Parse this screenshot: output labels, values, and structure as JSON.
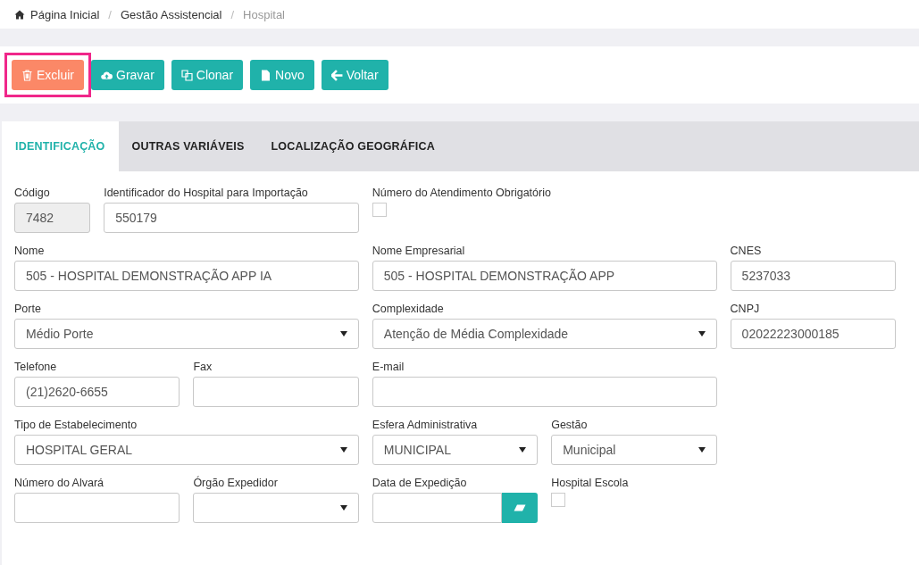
{
  "breadcrumb": [
    {
      "label": "Página Inicial",
      "current": false
    },
    {
      "label": "Gestão Assistencial",
      "current": false
    },
    {
      "label": "Hospital",
      "current": true
    }
  ],
  "breadcrumb_separator": "/",
  "toolbar": [
    {
      "label": "Excluir",
      "kind": "danger",
      "highlighted": true
    },
    {
      "label": "Gravar",
      "kind": "primary",
      "highlighted": false
    },
    {
      "label": "Clonar",
      "kind": "primary",
      "highlighted": false
    },
    {
      "label": "Novo",
      "kind": "primary",
      "highlighted": false
    },
    {
      "label": "Voltar",
      "kind": "primary",
      "highlighted": false
    }
  ],
  "tabs": [
    {
      "label": "IDENTIFICAÇÃO",
      "selected": true
    },
    {
      "label": "OUTRAS VARIÁVEIS",
      "selected": false
    },
    {
      "label": "LOCALIZAÇÃO GEOGRÁFICA",
      "selected": false
    }
  ],
  "form_rows": [
    [
      {
        "kind": "text",
        "label": "Código",
        "value": "7482",
        "disabled": true
      },
      {
        "kind": "text",
        "label": "Identificador do Hospital para Importação",
        "value": "550179",
        "disabled": false
      },
      {
        "kind": "checkbox",
        "label": "Número do Atendimento Obrigatório",
        "checked": false
      }
    ],
    [
      {
        "kind": "text",
        "label": "Nome",
        "value": "505 - HOSPITAL DEMONSTRAÇÃO APP IA",
        "disabled": false
      },
      {
        "kind": "text",
        "label": "Nome Empresarial",
        "value": "505 - HOSPITAL DEMONSTRAÇÃO APP",
        "disabled": false
      },
      {
        "kind": "text",
        "label": "CNES",
        "value": "5237033",
        "disabled": false
      }
    ],
    [
      {
        "kind": "select",
        "label": "Porte",
        "value": "Médio Porte"
      },
      {
        "kind": "select",
        "label": "Complexidade",
        "value": "Atenção de Média Complexidade"
      },
      {
        "kind": "text",
        "label": "CNPJ",
        "value": "02022223000185",
        "disabled": false
      }
    ],
    [
      {
        "kind": "text",
        "label": "Telefone",
        "value": "(21)2620-6655",
        "disabled": false
      },
      {
        "kind": "text",
        "label": "Fax",
        "disabled": false
      },
      {
        "kind": "text",
        "label": "E-mail",
        "disabled": false
      }
    ],
    [
      {
        "kind": "select",
        "label": "Tipo de Estabelecimento",
        "value": "HOSPITAL GERAL"
      },
      {
        "kind": "select",
        "label": "Esfera Administrativa",
        "value": "MUNICIPAL"
      },
      {
        "kind": "select",
        "label": "Gestão",
        "value": "Municipal"
      }
    ],
    [
      {
        "kind": "text",
        "label": "Número do Alvará",
        "disabled": false
      },
      {
        "kind": "select",
        "label": "Órgão Expedidor"
      },
      {
        "kind": "date",
        "label": "Data de Expedição"
      },
      {
        "kind": "checkbox",
        "label": "Hospital Escola",
        "checked": false
      }
    ]
  ]
}
